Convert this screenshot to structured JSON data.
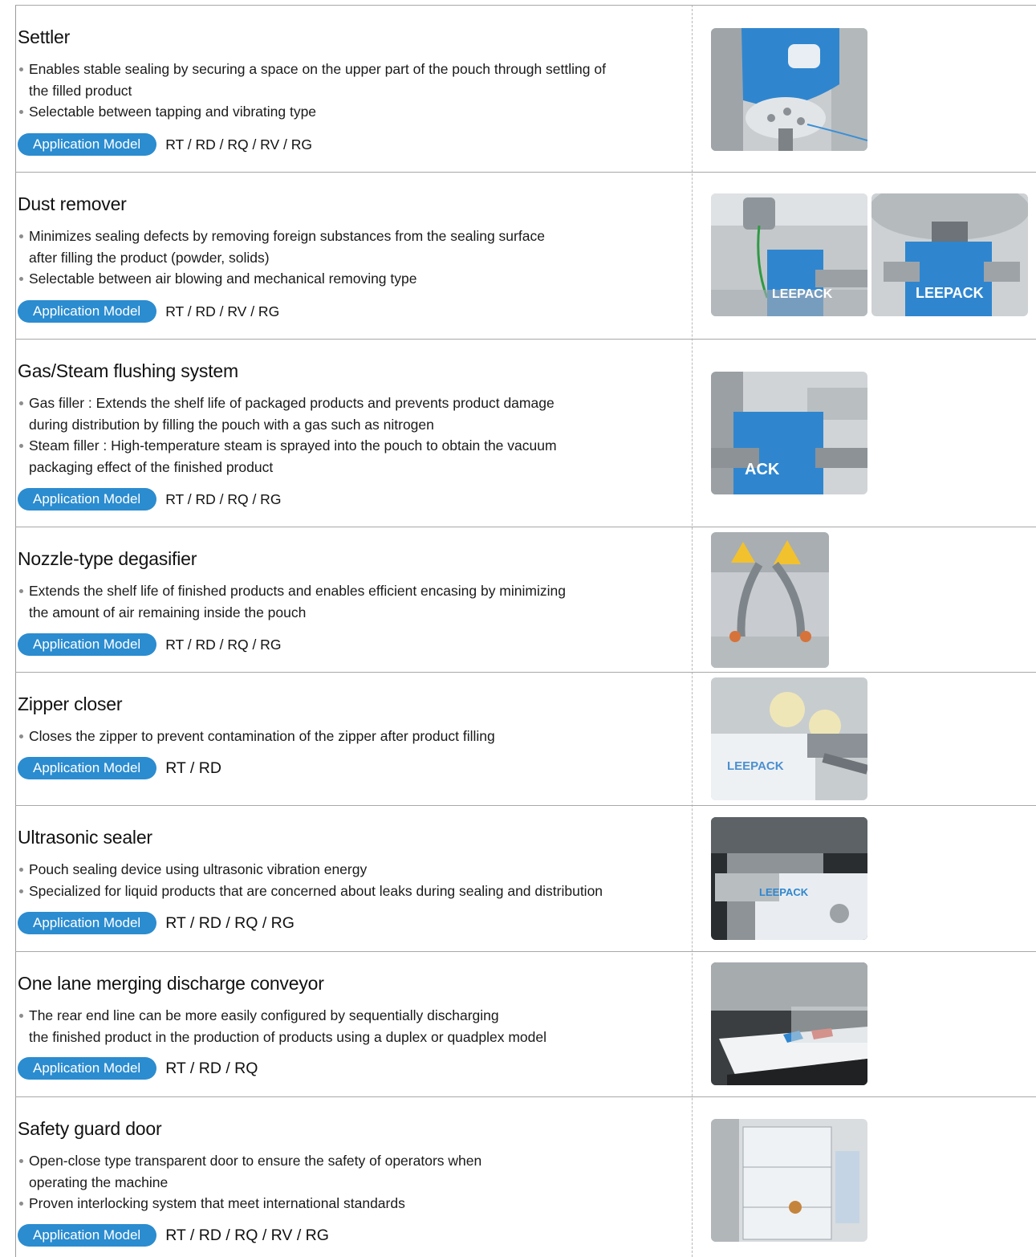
{
  "application_model_label": "Application Model",
  "sections": [
    {
      "title": "Settler",
      "bullets": [
        [
          "Enables stable sealing by securing a space on the upper part of the pouch through settling of",
          "the filled product"
        ],
        [
          "Selectable between tapping and vibrating type"
        ]
      ],
      "models": "RT / RD / RQ / RV / RG",
      "photos": [
        "settler-photo"
      ]
    },
    {
      "title": "Dust remover",
      "bullets": [
        [
          "Minimizes sealing defects by removing foreign substances from the sealing surface",
          "after filling the product (powder, solids)"
        ],
        [
          "Selectable between air blowing and mechanical removing type"
        ]
      ],
      "models": "RT / RD / RV / RG",
      "photos": [
        "dust-remover-photo-1",
        "dust-remover-photo-2"
      ],
      "photo_text": "LEEPACK"
    },
    {
      "title": "Gas/Steam flushing system",
      "bullets": [
        [
          "Gas filler : Extends the shelf life of packaged products and prevents product damage",
          "during distribution by filling the pouch with a gas such as nitrogen"
        ],
        [
          "Steam filler : High-temperature steam is sprayed into the pouch to obtain the vacuum",
          "packaging effect of the finished product"
        ]
      ],
      "models": "RT / RD / RQ / RG",
      "photos": [
        "gas-steam-photo"
      ],
      "photo_text": "ACK"
    },
    {
      "title": "Nozzle-type degasifier",
      "bullets": [
        [
          "Extends the shelf life of finished products and enables efficient encasing by minimizing",
          "the amount of air remaining inside the pouch"
        ]
      ],
      "models": "RT / RD / RQ / RG",
      "photos": [
        "degasifier-photo"
      ]
    },
    {
      "title": "Zipper closer",
      "bullets": [
        [
          "Closes the zipper to prevent contamination of the zipper after product filling"
        ]
      ],
      "models": "RT / RD",
      "photos": [
        "zipper-closer-photo"
      ],
      "photo_text": "LEEPACK"
    },
    {
      "title": "Ultrasonic sealer",
      "bullets": [
        [
          "Pouch sealing device using ultrasonic vibration energy"
        ],
        [
          "Specialized for liquid products that are concerned about leaks during sealing and distribution"
        ]
      ],
      "models": "RT / RD / RQ / RG",
      "photos": [
        "ultrasonic-sealer-photo"
      ],
      "photo_text": "LEEPACK"
    },
    {
      "title": "One lane merging discharge conveyor",
      "bullets": [
        [
          "The rear end line can be more easily configured by sequentially discharging",
          "the finished  product in the production of products using a duplex or quadplex model"
        ]
      ],
      "models": "RT / RD / RQ",
      "photos": [
        "conveyor-photo"
      ]
    },
    {
      "title": "Safety guard door",
      "bullets": [
        [
          "Open-close type transparent door to ensure the safety of operators when",
          "operating the machine"
        ],
        [
          "Proven interlocking system that meet international standards"
        ]
      ],
      "models": "RT / RD / RQ / RV / RG",
      "photos": [
        "safety-door-photo"
      ]
    }
  ],
  "colors": {
    "pill": "#2b8cd0",
    "pouch_blue": "#2f86cf",
    "divider": "#a8a8a8"
  }
}
